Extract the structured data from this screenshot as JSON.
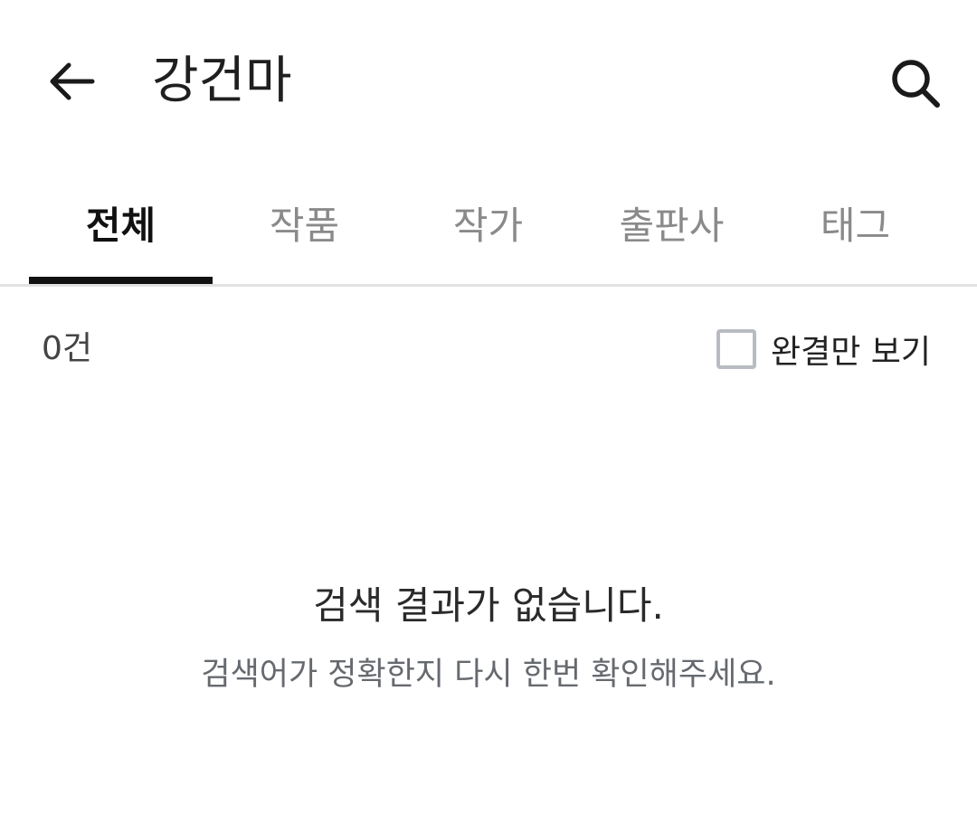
{
  "header": {
    "title": "강건마",
    "back_icon": "arrow-left-icon",
    "search_icon": "search-icon"
  },
  "tabs": [
    {
      "label": "전체",
      "active": true
    },
    {
      "label": "작품",
      "active": false
    },
    {
      "label": "작가",
      "active": false
    },
    {
      "label": "출판사",
      "active": false
    },
    {
      "label": "태그",
      "active": false
    }
  ],
  "filter": {
    "count_text": "0건",
    "complete_only_label": "완결만 보기",
    "complete_only_checked": false
  },
  "empty_state": {
    "title": "검색 결과가 없습니다.",
    "description": "검색어가 정확한지 다시 한번 확인해주세요."
  },
  "colors": {
    "active_tab": "#111111",
    "inactive_tab": "#8a8a8a",
    "divider": "#e2e2e2",
    "checkbox_border": "#b8bcc2"
  }
}
